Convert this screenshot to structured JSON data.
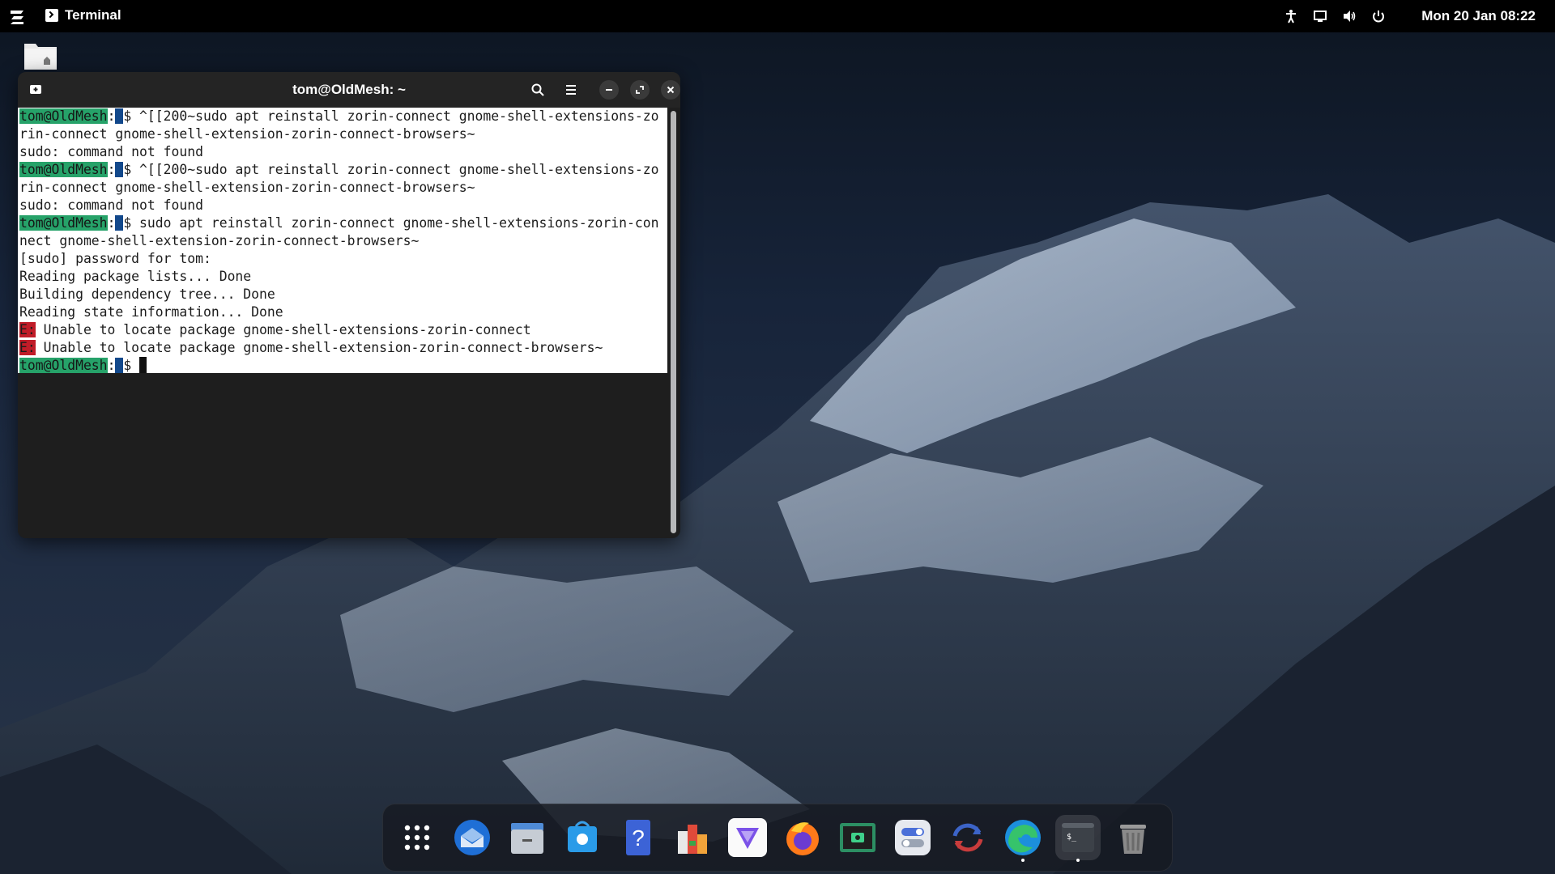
{
  "topbar": {
    "app_name": "Terminal",
    "clock": "Mon 20 Jan  08:22",
    "tray_icons": [
      "accessibility-icon",
      "display-icon",
      "volume-icon",
      "power-icon"
    ]
  },
  "terminal": {
    "title": "tom@OldMesh: ~",
    "lines": [
      {
        "type": "prompt",
        "user": "tom@OldMesh",
        "path": " ",
        "rest": "$ ^[[200~sudo apt reinstall zorin-connect gnome-shell-extensions-zo"
      },
      {
        "type": "text",
        "text": "rin-connect gnome-shell-extension-zorin-connect-browsers~"
      },
      {
        "type": "text",
        "text": "sudo: command not found"
      },
      {
        "type": "prompt",
        "user": "tom@OldMesh",
        "path": " ",
        "rest": "$ ^[[200~sudo apt reinstall zorin-connect gnome-shell-extensions-zo"
      },
      {
        "type": "text",
        "text": "rin-connect gnome-shell-extension-zorin-connect-browsers~"
      },
      {
        "type": "text",
        "text": "sudo: command not found"
      },
      {
        "type": "prompt",
        "user": "tom@OldMesh",
        "path": " ",
        "rest": "$ sudo apt reinstall zorin-connect gnome-shell-extensions-zorin-con"
      },
      {
        "type": "text",
        "text": "nect gnome-shell-extension-zorin-connect-browsers~"
      },
      {
        "type": "text",
        "text": "[sudo] password for tom:"
      },
      {
        "type": "text",
        "text": "Reading package lists... Done"
      },
      {
        "type": "text",
        "text": "Building dependency tree... Done"
      },
      {
        "type": "text",
        "text": "Reading state information... Done"
      },
      {
        "type": "error",
        "tag": "E:",
        "text": " Unable to locate package gnome-shell-extensions-zorin-connect"
      },
      {
        "type": "error",
        "tag": "E:",
        "text": " Unable to locate package gnome-shell-extension-zorin-connect-browsers~"
      },
      {
        "type": "prompt",
        "user": "tom@OldMesh",
        "path": " ",
        "rest": "$ ",
        "cursor": true
      }
    ]
  },
  "dock": {
    "items": [
      {
        "name": "app-grid-icon",
        "running": false,
        "active": false
      },
      {
        "name": "thunderbird-icon",
        "running": false,
        "active": false
      },
      {
        "name": "files-icon",
        "running": false,
        "active": false
      },
      {
        "name": "software-store-icon",
        "running": false,
        "active": false
      },
      {
        "name": "help-icon",
        "running": false,
        "active": false
      },
      {
        "name": "office-icon",
        "running": false,
        "active": false
      },
      {
        "name": "proton-vpn-icon",
        "running": false,
        "active": false
      },
      {
        "name": "firefox-icon",
        "running": false,
        "active": false
      },
      {
        "name": "screenshot-icon",
        "running": false,
        "active": false
      },
      {
        "name": "settings-toggle-icon",
        "running": false,
        "active": false
      },
      {
        "name": "sync-icon",
        "running": false,
        "active": false
      },
      {
        "name": "edge-browser-icon",
        "running": true,
        "active": false
      },
      {
        "name": "terminal-icon",
        "running": true,
        "active": true
      },
      {
        "name": "trash-icon",
        "running": false,
        "active": false
      }
    ]
  },
  "colors": {
    "prompt_green": "#26a269",
    "prompt_blue": "#12488b",
    "error_red": "#c01c28",
    "terminal_bg": "#1e1e1e",
    "header_bg": "#242424"
  }
}
